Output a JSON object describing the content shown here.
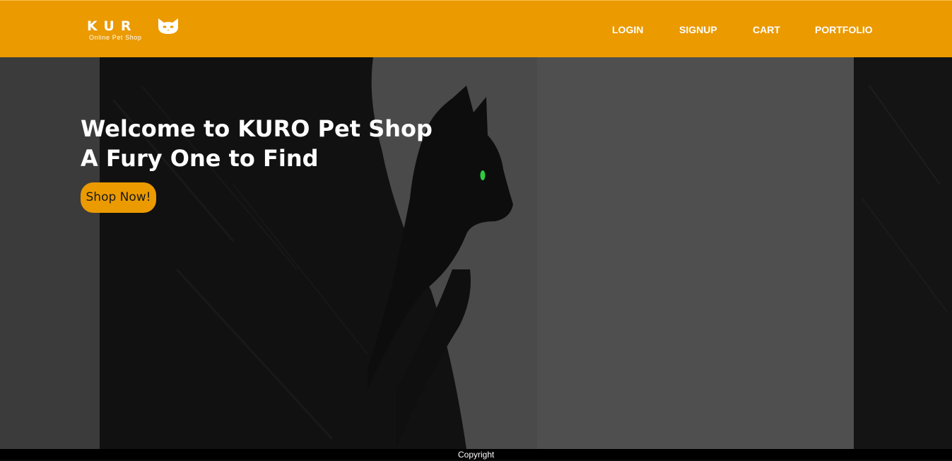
{
  "header": {
    "logo_text": "KUR",
    "logo_icon": "cat-head-icon",
    "logo_subtitle": "Online Pet Shop",
    "nav": {
      "login": "LOGIN",
      "signup": "SIGNUP",
      "cart": "CART",
      "portfolio": "PORTFOLIO"
    }
  },
  "hero": {
    "title_line1": "Welcome to KURO Pet Shop",
    "title_line2": "A Fury One to Find",
    "button_label": "Shop Now!",
    "image_subject": "black cat silhouette"
  },
  "footer": {
    "text": "Copyright"
  },
  "colors": {
    "accent": "#eb9a00",
    "header_text": "#ffffff",
    "footer_bg": "#000000",
    "cat_eye": "#2ecc40"
  }
}
